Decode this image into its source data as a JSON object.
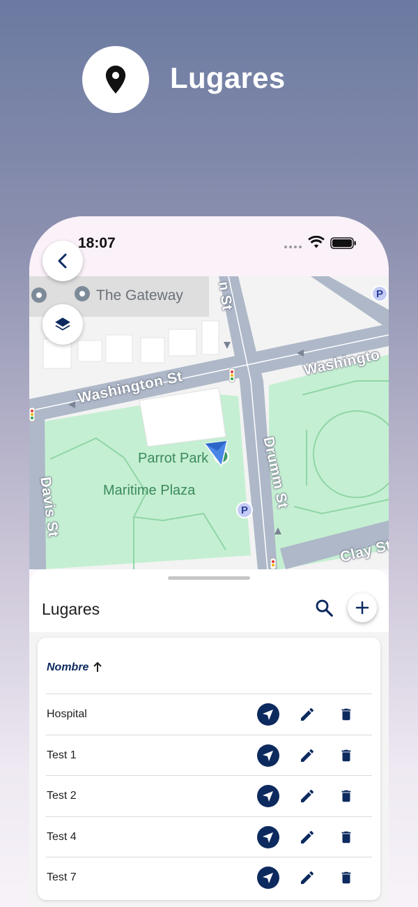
{
  "header": {
    "title": "Lugares",
    "icon": "location-pin-icon"
  },
  "status_bar": {
    "time": "18:07"
  },
  "map": {
    "labels": {
      "the_gateway": "The Gateway",
      "washington_st_left": "Washington St",
      "washington_st_right": "Washingto",
      "parrot_park": "Parrot Park",
      "maritime_plaza": "Maritime Plaza",
      "drumm_st": "Drumm St",
      "davis_st": "Davis St",
      "clay_st": "Clay St",
      "top_st": "n St",
      "parking": "P"
    },
    "colors": {
      "park": "#c4eed0",
      "road": "#aab4c4",
      "block": "#e6e6e6"
    }
  },
  "sheet": {
    "title": "Lugares",
    "table": {
      "column_name": "Nombre",
      "sort": "ascending",
      "rows": [
        {
          "name": "Hospital"
        },
        {
          "name": "Test 1"
        },
        {
          "name": "Test 2"
        },
        {
          "name": "Test 4"
        },
        {
          "name": "Test 7"
        }
      ]
    }
  },
  "colors": {
    "accent": "#0d2a5f"
  }
}
